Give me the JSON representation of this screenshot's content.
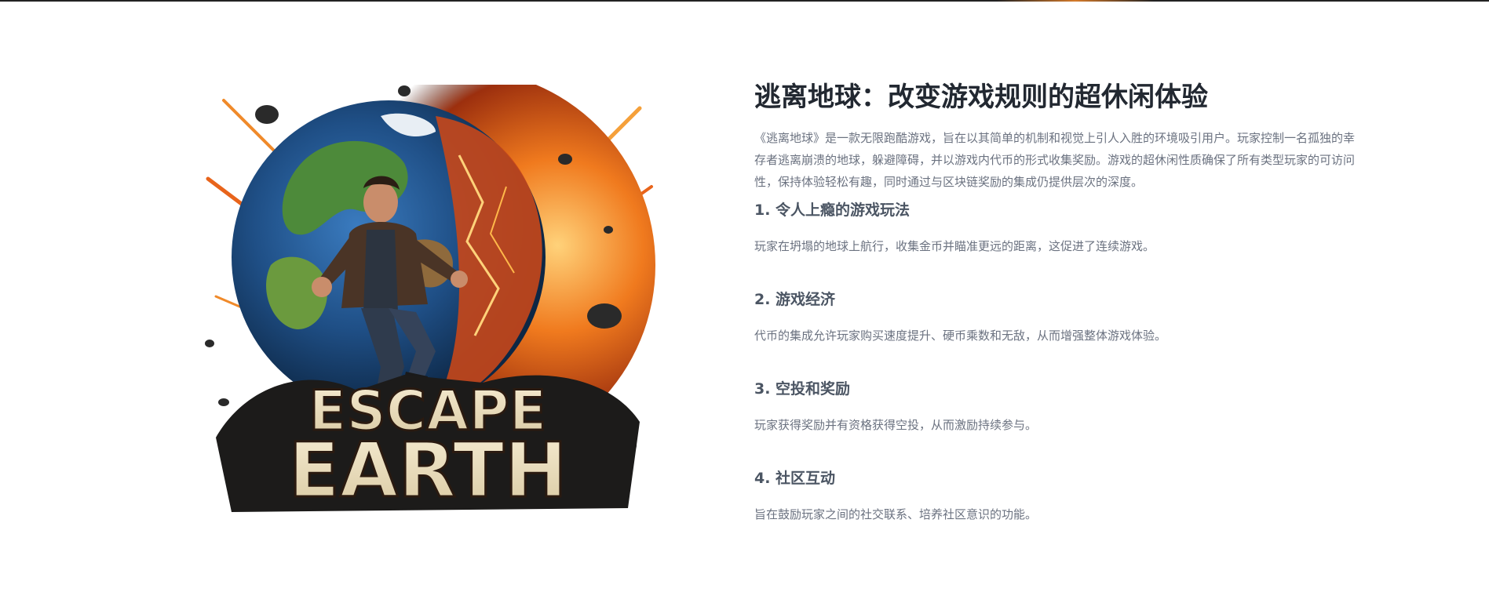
{
  "hero": {
    "logo_text_line1": "ESCAPE",
    "logo_text_line2": "EARTH"
  },
  "content": {
    "title": "逃离地球：改变游戏规则的超休闲体验",
    "intro": "《逃离地球》是一款无限跑酷游戏，旨在以其简单的机制和视觉上引人入胜的环境吸引用户。玩家控制一名孤独的幸存者逃离崩溃的地球，躲避障碍，并以游戏内代币的形式收集奖励。游戏的超休闲性质确保了所有类型玩家的可访问性，保持体验轻松有趣，同时通过与区块链奖励的集成仍提供层次的深度。",
    "features": [
      {
        "title": "1. 令人上瘾的游戏玩法",
        "desc": "玩家在坍塌的地球上航行，收集金币并瞄准更远的距离，这促进了连续游戏。"
      },
      {
        "title": "2. 游戏经济",
        "desc": "代币的集成允许玩家购买速度提升、硬币乘数和无敌，从而增强整体游戏体验。"
      },
      {
        "title": "3. 空投和奖励",
        "desc": "玩家获得奖励并有资格获得空投，从而激励持续参与。"
      },
      {
        "title": "4. 社区互动",
        "desc": "旨在鼓励玩家之间的社交联系、培养社区意识的功能。"
      }
    ]
  },
  "colors": {
    "title": "#222831",
    "body_text": "#6b7280",
    "feature_title": "#4b5563",
    "accent_fire": "#e8641b"
  }
}
